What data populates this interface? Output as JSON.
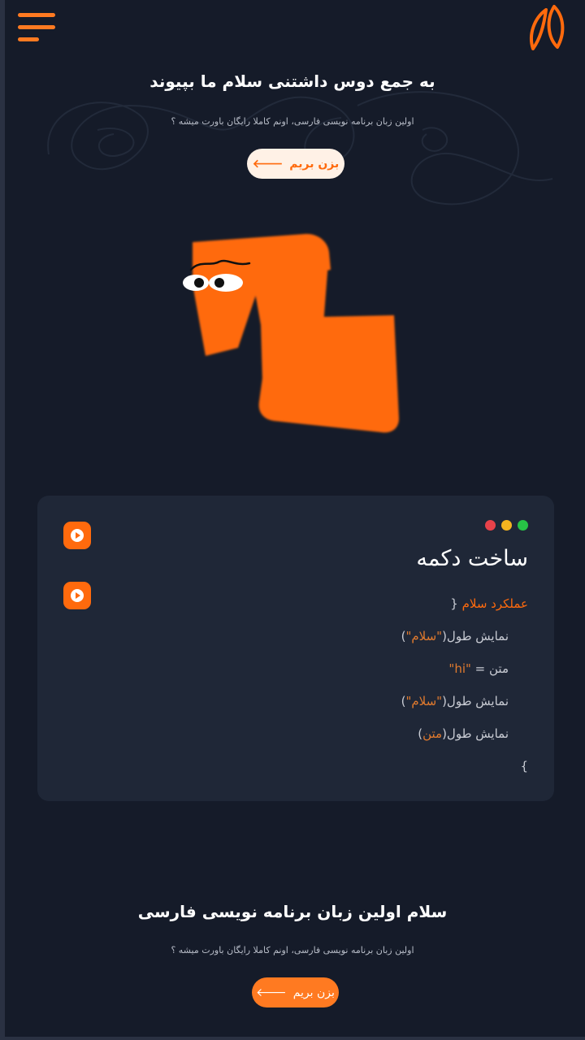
{
  "colors": {
    "background": "#151b29",
    "accent": "#ff6a0d",
    "card": "#1f2737",
    "hero_button_bg": "#fff1e6"
  },
  "header": {
    "menu_icon": "hamburger-menu-icon",
    "logo_icon": "leaf-logo-icon"
  },
  "hero": {
    "title": "به جمع دوس داشتنی سلام ما بپیوند",
    "subtitle": "اولین زبان برنامه نویسی فارسی، اونم کاملا رایگان باورت میشه ؟",
    "button_label": "بزن بریم",
    "button_icon": "arrow-left-icon"
  },
  "code_card": {
    "window_dots": [
      "#e8424a",
      "#f4b41f",
      "#27c246"
    ],
    "title": "ساخت دکمه",
    "play_icon": "play-icon",
    "lines": [
      {
        "keyword": "عملکرد سلام",
        "rest": " {"
      },
      {
        "fn": "نمایش طول(",
        "str": "\"سلام\"",
        "end": ")"
      },
      {
        "fn": "متن = ",
        "str": "\"hi\""
      },
      {
        "fn": "نمایش طول(",
        "str": "\"سلام\"",
        "end": ")"
      },
      {
        "fn": "نمایش طول(",
        "str": "متن",
        "end": ")"
      },
      {
        "close": "}"
      }
    ]
  },
  "footer_section": {
    "title": "سلام اولین زبان برنامه نویسی فارسی",
    "subtitle": "اولین زبان برنامه نویسی فارسی، اونم کاملا رایگان باورت میشه ؟",
    "button_label": "بزن بریم",
    "button_icon": "arrow-left-icon"
  }
}
